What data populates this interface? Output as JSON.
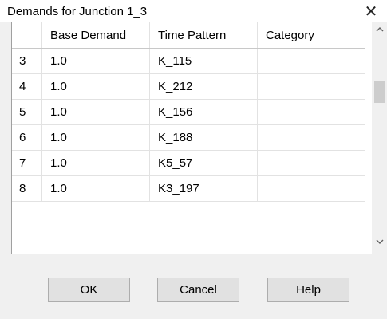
{
  "window": {
    "title": "Demands for Junction 1_3",
    "close_glyph": "✕"
  },
  "grid": {
    "columns": [
      "",
      "Base Demand",
      "Time Pattern",
      "Category"
    ],
    "rows": [
      [
        "3",
        "1.0",
        "K_115",
        ""
      ],
      [
        "4",
        "1.0",
        "K_212",
        ""
      ],
      [
        "5",
        "1.0",
        "K_156",
        ""
      ],
      [
        "6",
        "1.0",
        "K_188",
        ""
      ],
      [
        "7",
        "1.0",
        "K5_57",
        ""
      ],
      [
        "8",
        "1.0",
        "K3_197",
        ""
      ]
    ]
  },
  "scrollbar": {
    "up_icon": "chevron-up-icon",
    "down_icon": "chevron-down-icon"
  },
  "buttons": {
    "ok": "OK",
    "cancel": "Cancel",
    "help": "Help"
  }
}
